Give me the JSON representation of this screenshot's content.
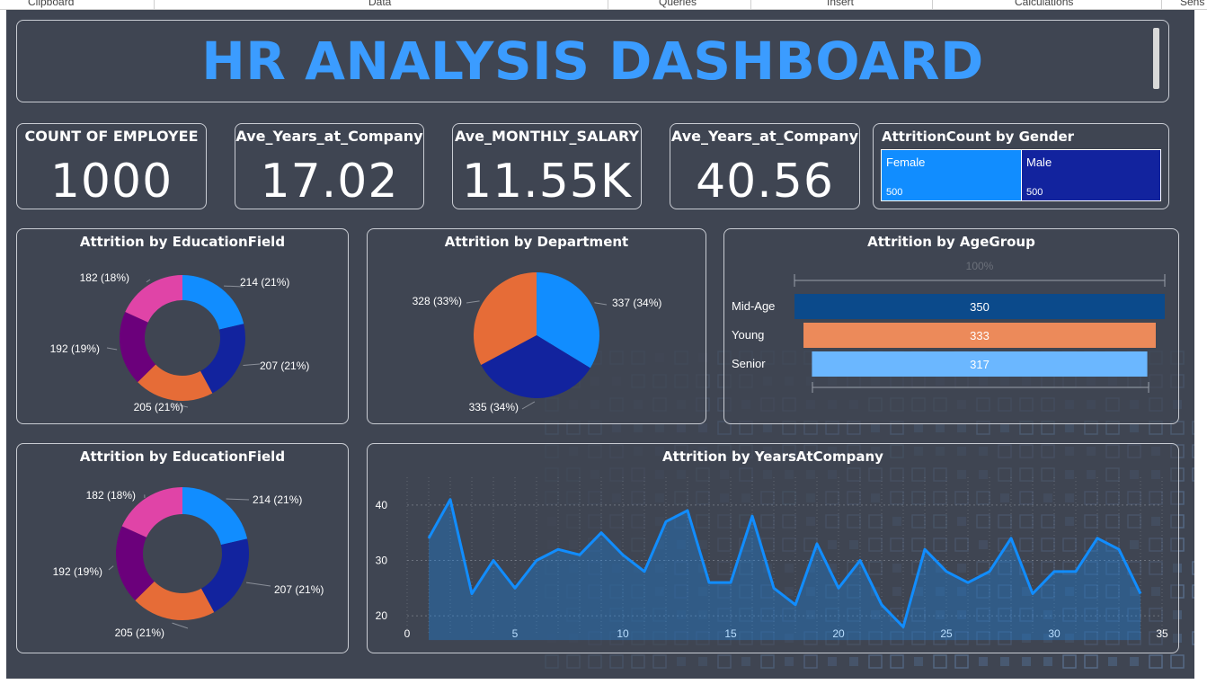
{
  "ribbon": {
    "groups": [
      "Clipboard",
      "Data",
      "Queries",
      "Insert",
      "Calculations",
      "Sens"
    ]
  },
  "header": {
    "title": "HR ANALYSIS DASHBOARD"
  },
  "cards": [
    {
      "label": "COUNT OF EMPLOYEE",
      "value": "1000"
    },
    {
      "label": "Ave_Years_at_Company",
      "value": "17.02"
    },
    {
      "label": "Ave_MONTHLY_SALARY",
      "value": "11.55K"
    },
    {
      "label": "Ave_Years_at_Company",
      "value": "40.56"
    }
  ],
  "treemap": {
    "title": "AttritionCount by Gender",
    "tiles": [
      {
        "name": "Female",
        "value": "500",
        "color": "#118dff"
      },
      {
        "name": "Male",
        "value": "500",
        "color": "#12239e"
      }
    ]
  },
  "chart_data": [
    {
      "type": "pie",
      "variant": "donut",
      "title": "Attrition by EducationField",
      "values": [
        214,
        207,
        205,
        192,
        182
      ],
      "labels": [
        "214 (21%)",
        "207 (21%)",
        "205 (21%)",
        "192 (19%)",
        "182 (18%)"
      ],
      "colors": [
        "#118dff",
        "#12239e",
        "#e66c37",
        "#6b007b",
        "#e044a7"
      ]
    },
    {
      "type": "pie",
      "title": "Attrition by Department",
      "values": [
        337,
        335,
        328
      ],
      "labels": [
        "337 (34%)",
        "335 (34%)",
        "328 (33%)"
      ],
      "colors": [
        "#118dff",
        "#12239e",
        "#e66c37"
      ]
    },
    {
      "type": "bar",
      "orientation": "horizontal",
      "title": "Attrition by AgeGroup",
      "categories": [
        "Mid-Age",
        "Young",
        "Senior"
      ],
      "values": [
        350,
        333,
        317
      ],
      "colors": [
        "#0b4a8b",
        "#ec8a5a",
        "#6bb7ff"
      ],
      "axis_label": "100%"
    },
    {
      "type": "pie",
      "variant": "donut",
      "title": "Attrition by EducationField",
      "values": [
        214,
        207,
        205,
        192,
        182
      ],
      "labels": [
        "214 (21%)",
        "207 (21%)",
        "205 (21%)",
        "192 (19%)",
        "182 (18%)"
      ],
      "colors": [
        "#118dff",
        "#12239e",
        "#e66c37",
        "#6b007b",
        "#e044a7"
      ]
    },
    {
      "type": "area",
      "title": "Attrition by YearsAtCompany",
      "x": [
        1,
        2,
        3,
        4,
        5,
        6,
        7,
        8,
        9,
        10,
        11,
        12,
        13,
        14,
        15,
        16,
        17,
        18,
        19,
        20,
        21,
        22,
        23,
        24,
        25,
        26,
        27,
        28,
        29,
        30,
        31,
        32,
        33,
        34
      ],
      "y": [
        34,
        41,
        24,
        30,
        25,
        30,
        32,
        31,
        35,
        31,
        28,
        37,
        39,
        26,
        26,
        38,
        25,
        22,
        33,
        25,
        30,
        22,
        18,
        32,
        28,
        26,
        28,
        34,
        24,
        28,
        28,
        34,
        32,
        24
      ],
      "xlim": [
        0,
        35
      ],
      "ylim": [
        15,
        45
      ],
      "xticks": [
        0,
        5,
        10,
        15,
        20,
        25,
        30,
        35
      ],
      "yticks": [
        20,
        30,
        40
      ],
      "color": "#118dff",
      "grid": true
    }
  ]
}
